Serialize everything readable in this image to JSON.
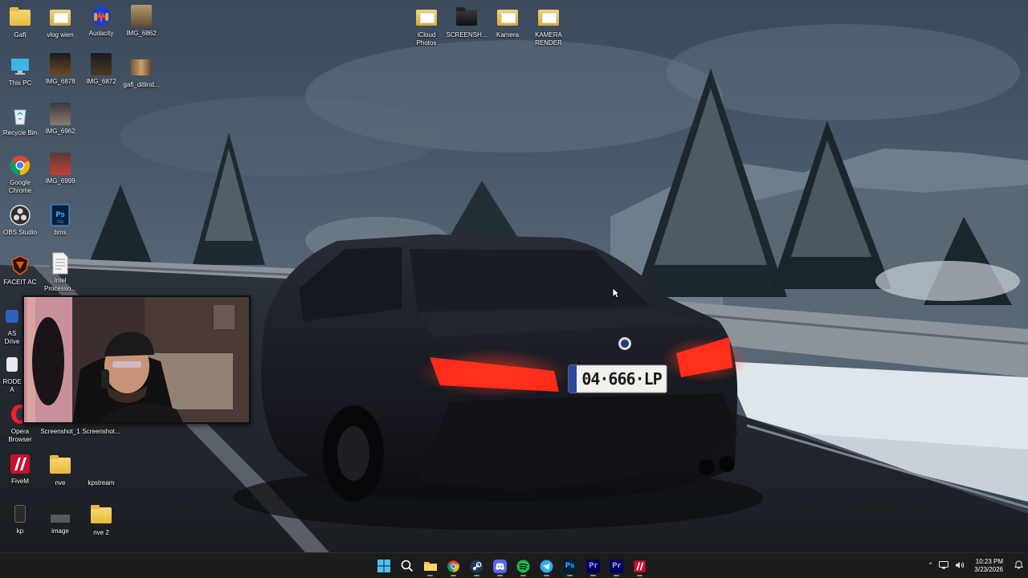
{
  "desktop": {
    "icons": [
      {
        "label": "Gafi",
        "icon": "folder-icon"
      },
      {
        "label": "vlog wien",
        "icon": "folder-icon"
      },
      {
        "label": "Audacity",
        "icon": "audacity-icon"
      },
      {
        "label": "IMG_6862",
        "icon": "image-icon"
      },
      {
        "label": "iCloud Photos",
        "icon": "icloud-folder-icon"
      },
      {
        "label": "SCREENSH...",
        "icon": "folder-icon"
      },
      {
        "label": "Kamera",
        "icon": "folder-icon"
      },
      {
        "label": "KAMERA RENDER",
        "icon": "folder-icon"
      },
      {
        "label": "This PC",
        "icon": "monitor-icon"
      },
      {
        "label": "IMG_6878",
        "icon": "image-icon"
      },
      {
        "label": "IMG_6872",
        "icon": "image-icon"
      },
      {
        "label": "gafi_ditlind...",
        "icon": "image-icon"
      },
      {
        "label": "Recycle Bin",
        "icon": "recycle-bin-icon"
      },
      {
        "label": "IMG_6962",
        "icon": "image-icon"
      },
      {
        "label": "Google Chrome",
        "icon": "chrome-icon"
      },
      {
        "label": "IMG_6999",
        "icon": "image-icon"
      },
      {
        "label": "OBS Studio",
        "icon": "obs-icon"
      },
      {
        "label": "bms",
        "icon": "photoshop-file-icon"
      },
      {
        "label": "FACEIT AC",
        "icon": "faceit-icon"
      },
      {
        "label": "Intel Processo...",
        "icon": "document-icon"
      },
      {
        "label": "AS Drive",
        "icon": "app-icon"
      },
      {
        "label": "RODE A",
        "icon": "app-icon"
      },
      {
        "label": "Opera Browser",
        "icon": "opera-icon"
      },
      {
        "label": "Screenshot_1",
        "icon": "image-icon"
      },
      {
        "label": "Screenshot...",
        "icon": "image-icon"
      },
      {
        "label": "FiveM",
        "icon": "fivem-icon"
      },
      {
        "label": "nve",
        "icon": "folder-icon"
      },
      {
        "label": "kpstream",
        "icon": "folder-icon"
      },
      {
        "label": "kp",
        "icon": "app-icon"
      },
      {
        "label": "image",
        "icon": "image-icon"
      },
      {
        "label": "nve 2",
        "icon": "folder-icon"
      }
    ]
  },
  "wallpaper": {
    "license_plate": "04·666·LP"
  },
  "taskbar": {
    "apps": [
      {
        "name": "start",
        "icon": "windows-start-icon"
      },
      {
        "name": "search",
        "icon": "search-icon"
      },
      {
        "name": "file-explorer",
        "icon": "file-explorer-icon"
      },
      {
        "name": "chrome",
        "icon": "chrome-icon"
      },
      {
        "name": "steam",
        "icon": "steam-icon"
      },
      {
        "name": "discord",
        "icon": "discord-icon"
      },
      {
        "name": "spotify",
        "icon": "spotify-icon"
      },
      {
        "name": "telegram",
        "icon": "telegram-icon"
      },
      {
        "name": "photoshop",
        "icon": "photoshop-icon",
        "text": "Ps"
      },
      {
        "name": "premiere-1",
        "icon": "premiere-icon",
        "text": "Pr"
      },
      {
        "name": "premiere-2",
        "icon": "premiere-icon",
        "text": "Pr"
      },
      {
        "name": "fivem",
        "icon": "fivem-icon"
      }
    ],
    "tray": {
      "time": "10:23 PM",
      "date": "3/23/2026"
    }
  },
  "colors": {
    "taskbar_bg": "#1c1c1c",
    "folder": "#e9b93c",
    "tail_light": "#ff2a1a"
  }
}
